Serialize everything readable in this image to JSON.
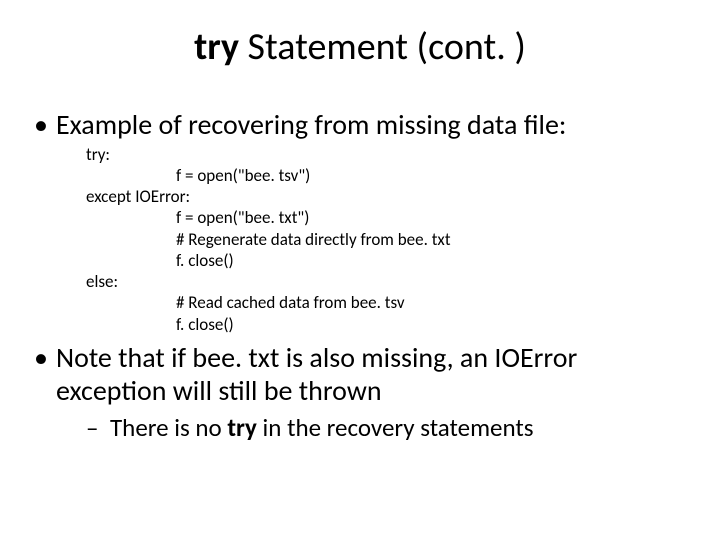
{
  "title_kw": "try",
  "title_rest": " Statement (cont. )",
  "bullets": {
    "b1": "Example of recovering from missing data file:",
    "code": {
      "l1": "try:",
      "l2": "f = open(\"bee. tsv\")",
      "l3": "except IOError:",
      "l4": "f = open(\"bee. txt\")",
      "l5": "# Regenerate data directly from bee. txt",
      "l6": "f. close()",
      "l7": "else:",
      "l8": "# Read cached data from bee. tsv",
      "l9": "f. close()"
    },
    "b2": "Note that if bee. txt is also missing, an IOError exception will still be thrown",
    "b2_sub_pre": "There is no ",
    "b2_sub_kw": "try",
    "b2_sub_post": " in the recovery statements"
  }
}
